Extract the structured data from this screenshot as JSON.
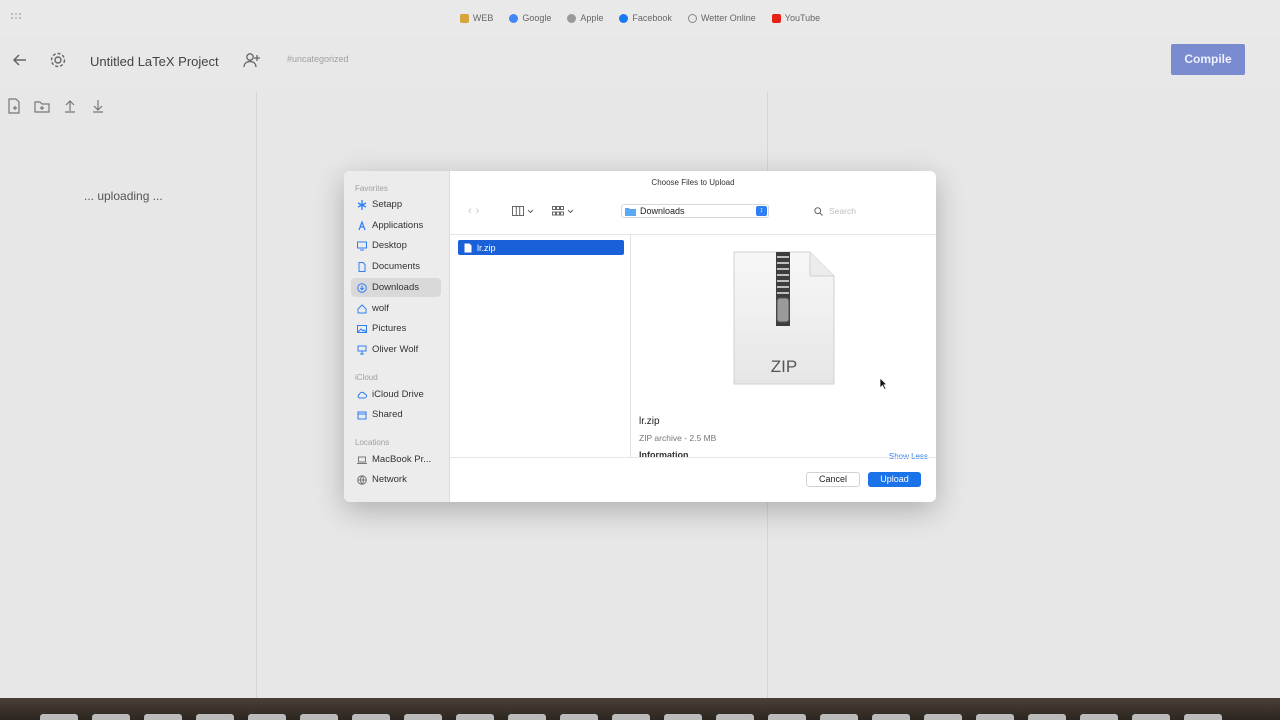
{
  "browser": {
    "bookmarks": [
      {
        "label": "WEB",
        "icon": "web-icon",
        "color": "#d6a53a"
      },
      {
        "label": "Google",
        "icon": "google-icon",
        "color": "#4285f4"
      },
      {
        "label": "Apple",
        "icon": "apple-icon",
        "color": "#888888"
      },
      {
        "label": "Facebook",
        "icon": "facebook-icon",
        "color": "#1877f2"
      },
      {
        "label": "Wetter Online",
        "icon": "weather-icon",
        "color": "#7a7a7a"
      },
      {
        "label": "YouTube",
        "icon": "youtube-icon",
        "color": "#e62117"
      }
    ]
  },
  "app": {
    "project_title": "Untitled LaTeX Project",
    "tag": "#uncategorized",
    "compile_label": "Compile",
    "uploading_text": "... uploading ...",
    "accent": "#7b8bd0"
  },
  "dialog": {
    "title": "Choose Files to Upload",
    "sidebar": {
      "favorites_label": "Favorites",
      "favorites": [
        {
          "label": "Setapp",
          "icon": "setapp-icon"
        },
        {
          "label": "Applications",
          "icon": "applications-icon"
        },
        {
          "label": "Desktop",
          "icon": "desktop-icon"
        },
        {
          "label": "Documents",
          "icon": "documents-icon"
        },
        {
          "label": "Downloads",
          "icon": "downloads-icon",
          "selected": true
        },
        {
          "label": "wolf",
          "icon": "home-icon"
        },
        {
          "label": "Pictures",
          "icon": "pictures-icon"
        },
        {
          "label": "Oliver Wolf",
          "icon": "user-folder-icon"
        }
      ],
      "icloud_label": "iCloud",
      "icloud": [
        {
          "label": "iCloud Drive",
          "icon": "icloud-icon"
        },
        {
          "label": "Shared",
          "icon": "shared-icon"
        }
      ],
      "locations_label": "Locations",
      "locations": [
        {
          "label": "MacBook Pr...",
          "icon": "laptop-icon"
        },
        {
          "label": "Network",
          "icon": "network-icon"
        }
      ]
    },
    "location": "Downloads",
    "search_placeholder": "Search",
    "files": [
      {
        "name": "lr.zip",
        "selected": true
      }
    ],
    "preview": {
      "badge": "ZIP",
      "name": "lr.zip",
      "meta": "ZIP archive - 2.5 MB",
      "info_label": "Information",
      "show_less": "Show Less"
    },
    "cancel_label": "Cancel",
    "upload_label": "Upload",
    "accent": "#1a73e8"
  }
}
